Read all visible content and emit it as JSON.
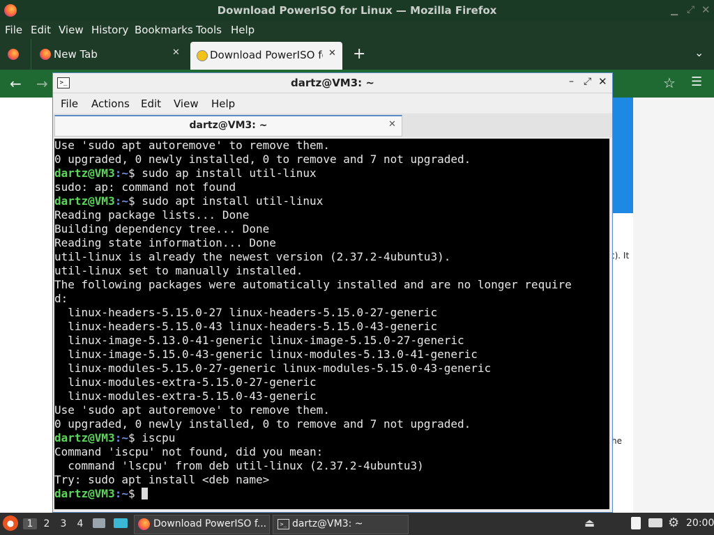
{
  "firefox": {
    "window_title": "Download PowerISO for Linux — Mozilla Firefox",
    "menu": [
      "File",
      "Edit",
      "View",
      "History",
      "Bookmarks",
      "Tools",
      "Help"
    ],
    "tabs": [
      {
        "label": "New Tab"
      },
      {
        "label": "Download PowerISO for L"
      }
    ]
  },
  "web_fragments": {
    "frag1": "c). It",
    "frag2": "he"
  },
  "terminal": {
    "window_title": "dartz@VM3: ~",
    "menu": [
      "File",
      "Actions",
      "Edit",
      "View",
      "Help"
    ],
    "tab_label": "dartz@VM3: ~",
    "prompt_user": "dartz@VM3",
    "prompt_path": ":~",
    "lines": [
      {
        "type": "out",
        "text": "Use 'sudo apt autoremove' to remove them."
      },
      {
        "type": "out",
        "text": "0 upgraded, 0 newly installed, 0 to remove and 7 not upgraded."
      },
      {
        "type": "cmd",
        "text": "$ sudo ap install util-linux"
      },
      {
        "type": "out",
        "text": "sudo: ap: command not found"
      },
      {
        "type": "cmd",
        "text": "$ sudo apt install util-linux"
      },
      {
        "type": "out",
        "text": "Reading package lists... Done"
      },
      {
        "type": "out",
        "text": "Building dependency tree... Done"
      },
      {
        "type": "out",
        "text": "Reading state information... Done"
      },
      {
        "type": "out",
        "text": "util-linux is already the newest version (2.37.2-4ubuntu3)."
      },
      {
        "type": "out",
        "text": "util-linux set to manually installed."
      },
      {
        "type": "out",
        "text": "The following packages were automatically installed and are no longer require"
      },
      {
        "type": "out",
        "text": "d:"
      },
      {
        "type": "out",
        "text": "  linux-headers-5.15.0-27 linux-headers-5.15.0-27-generic"
      },
      {
        "type": "out",
        "text": "  linux-headers-5.15.0-43 linux-headers-5.15.0-43-generic"
      },
      {
        "type": "out",
        "text": "  linux-image-5.13.0-41-generic linux-image-5.15.0-27-generic"
      },
      {
        "type": "out",
        "text": "  linux-image-5.15.0-43-generic linux-modules-5.13.0-41-generic"
      },
      {
        "type": "out",
        "text": "  linux-modules-5.15.0-27-generic linux-modules-5.15.0-43-generic"
      },
      {
        "type": "out",
        "text": "  linux-modules-extra-5.15.0-27-generic"
      },
      {
        "type": "out",
        "text": "  linux-modules-extra-5.15.0-43-generic"
      },
      {
        "type": "out",
        "text": "Use 'sudo apt autoremove' to remove them."
      },
      {
        "type": "out",
        "text": "0 upgraded, 0 newly installed, 0 to remove and 7 not upgraded."
      },
      {
        "type": "cmd",
        "text": "$ iscpu"
      },
      {
        "type": "out",
        "text": "Command 'iscpu' not found, did you mean:"
      },
      {
        "type": "out",
        "text": "  command 'lscpu' from deb util-linux (2.37.2-4ubuntu3)"
      },
      {
        "type": "out",
        "text": "Try: sudo apt install <deb name>"
      },
      {
        "type": "cur",
        "text": "$ "
      }
    ]
  },
  "taskbar": {
    "workspaces": [
      "1",
      "2",
      "3",
      "4"
    ],
    "tasks": [
      {
        "label": "Download PowerISO f..."
      },
      {
        "label": "dartz@VM3: ~"
      }
    ],
    "clock": "20:00"
  },
  "icons": {
    "firefox": "firefox-icon",
    "terminal": "terminal-icon",
    "star": "star-icon",
    "menu": "hamburger-icon"
  }
}
